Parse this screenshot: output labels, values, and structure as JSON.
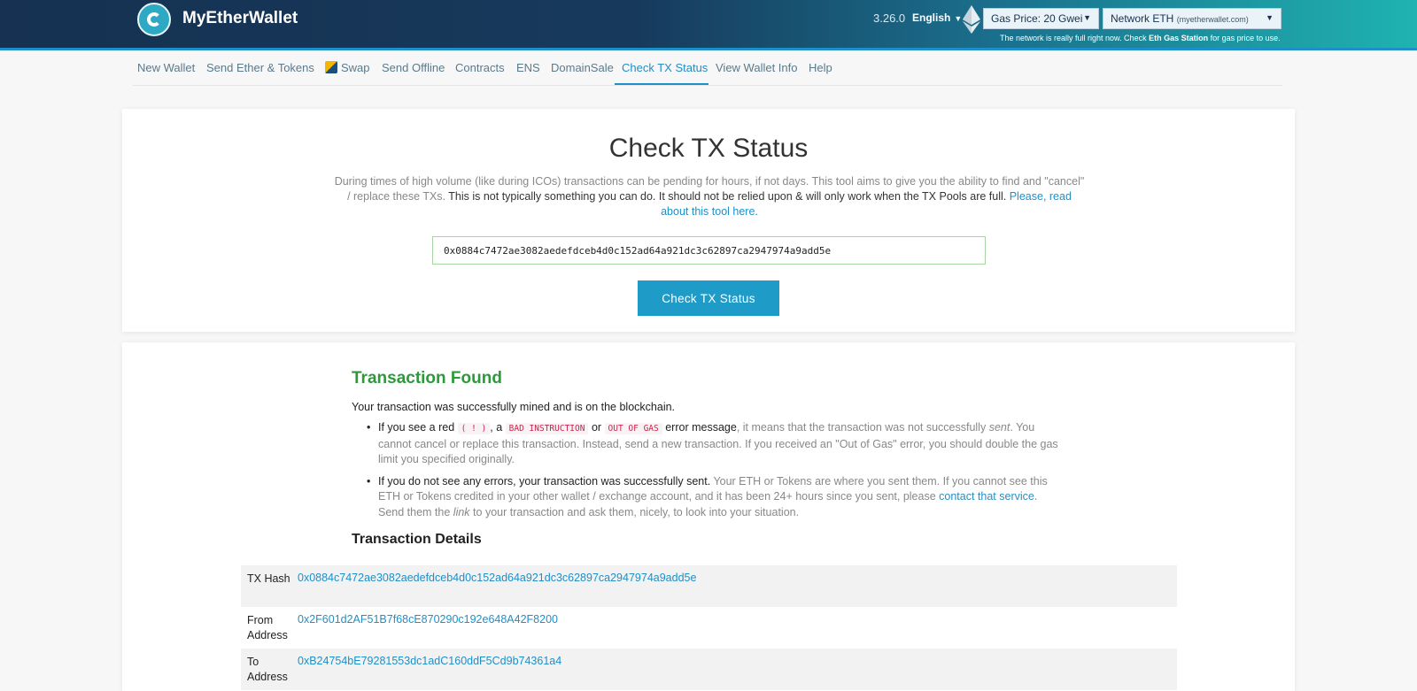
{
  "header": {
    "brand": "MyEtherWallet",
    "version": "3.26.0",
    "language": "English",
    "gas_price": "Gas Price: 20 Gwei",
    "network_label": "Network ETH",
    "network_host": "(myetherwallet.com)",
    "gas_note_pre": "The network is really full right now. Check",
    "gas_note_link": "Eth Gas Station",
    "gas_note_post": "for gas price to use."
  },
  "nav": {
    "items": [
      "New Wallet",
      "Send Ether & Tokens",
      "Swap",
      "Send Offline",
      "Contracts",
      "ENS",
      "DomainSale",
      "Check TX Status",
      "View Wallet Info",
      "Help"
    ],
    "active": "Check TX Status"
  },
  "check": {
    "title": "Check TX Status",
    "desc_1": "During times of high volume (like during ICOs) transactions can be pending for hours, if not days. This tool aims to give you the ability to find and \"cancel\" / replace these TXs.",
    "desc_2": "This is not typically something you can do. It should not be relied upon & will only work when the TX Pools are full.",
    "desc_link": "Please, read about this tool here.",
    "input_value": "0x0884c7472ae3082aedefdceb4d0c152ad64a921dc3c62897ca2947974a9add5e",
    "button": "Check TX Status"
  },
  "result": {
    "title": "Transaction Found",
    "success": "Your transaction was successfully mined and is on the blockchain.",
    "b1_a": "If you see a red",
    "b1_code1": "( ! )",
    "b1_b": ", a",
    "b1_code2": "BAD INSTRUCTION",
    "b1_c": "or",
    "b1_code3": "OUT OF GAS",
    "b1_d": "error message",
    "b1_e": ", it means that the transaction was not successfully",
    "b1_sent": "sent",
    "b1_f": ". You cannot cancel or replace this transaction. Instead, send a new transaction. If you received an \"Out of Gas\" error, you should double the gas limit you specified originally.",
    "b2_a": "If you do not see any errors, your transaction was successfully sent.",
    "b2_b": "Your ETH or Tokens are where you sent them. If you cannot see this ETH or Tokens credited in your other wallet / exchange account, and it has been 24+ hours since you sent, please",
    "b2_link": "contact that service",
    "b2_c": ". Send them the",
    "b2_link_word": "link",
    "b2_d": "to your transaction and ask them, nicely, to look into your situation.",
    "details_title": "Transaction Details",
    "rows": [
      {
        "label": "TX Hash",
        "value": "0x0884c7472ae3082aedefdceb4d0c152ad64a921dc3c62897ca2947974a9add5e"
      },
      {
        "label": "From Address",
        "value": "0x2F601d2AF51B7f68cE870290c192e648A42F8200"
      },
      {
        "label": "To Address",
        "value": "0xB24754bE79281553dc1adC160ddF5Cd9b74361a4"
      }
    ]
  },
  "colors": {
    "accent": "#1f8fc7",
    "success": "#2c9a3b",
    "header_dark": "#163151",
    "header_light": "#1fb3b1"
  }
}
